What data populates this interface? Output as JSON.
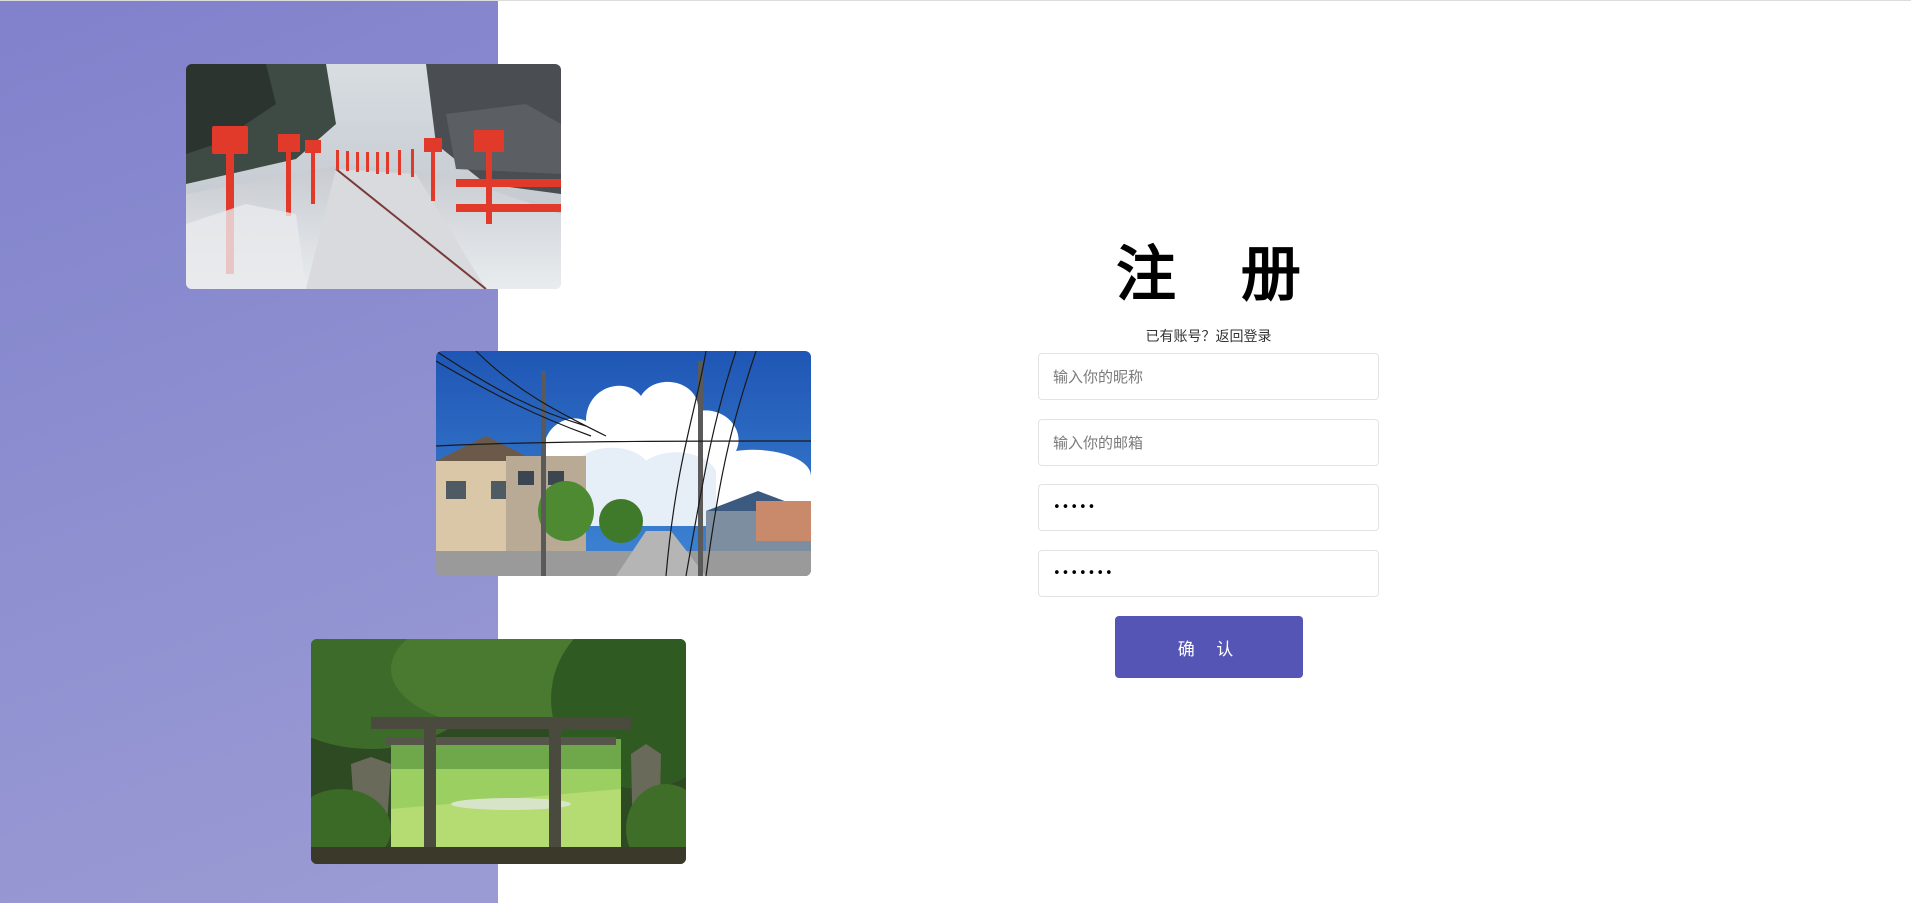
{
  "register": {
    "title": "注 册",
    "subtitle_prefix": "已有账号？",
    "login_link": "返回登录",
    "nickname": {
      "placeholder": "输入你的昵称",
      "value": ""
    },
    "email": {
      "placeholder": "输入你的邮箱",
      "value": ""
    },
    "password": {
      "value": "•••••"
    },
    "confirm_password": {
      "value": "•••••••"
    },
    "confirm_button": "确 认"
  },
  "images": [
    {
      "name": "snowy-lantern-stairs"
    },
    {
      "name": "street-clouds-powerlines"
    },
    {
      "name": "torii-gate-forest"
    }
  ],
  "colors": {
    "left_panel": "#8a8bcf",
    "button": "#5555b5",
    "field_border": "#e3e3e3"
  }
}
